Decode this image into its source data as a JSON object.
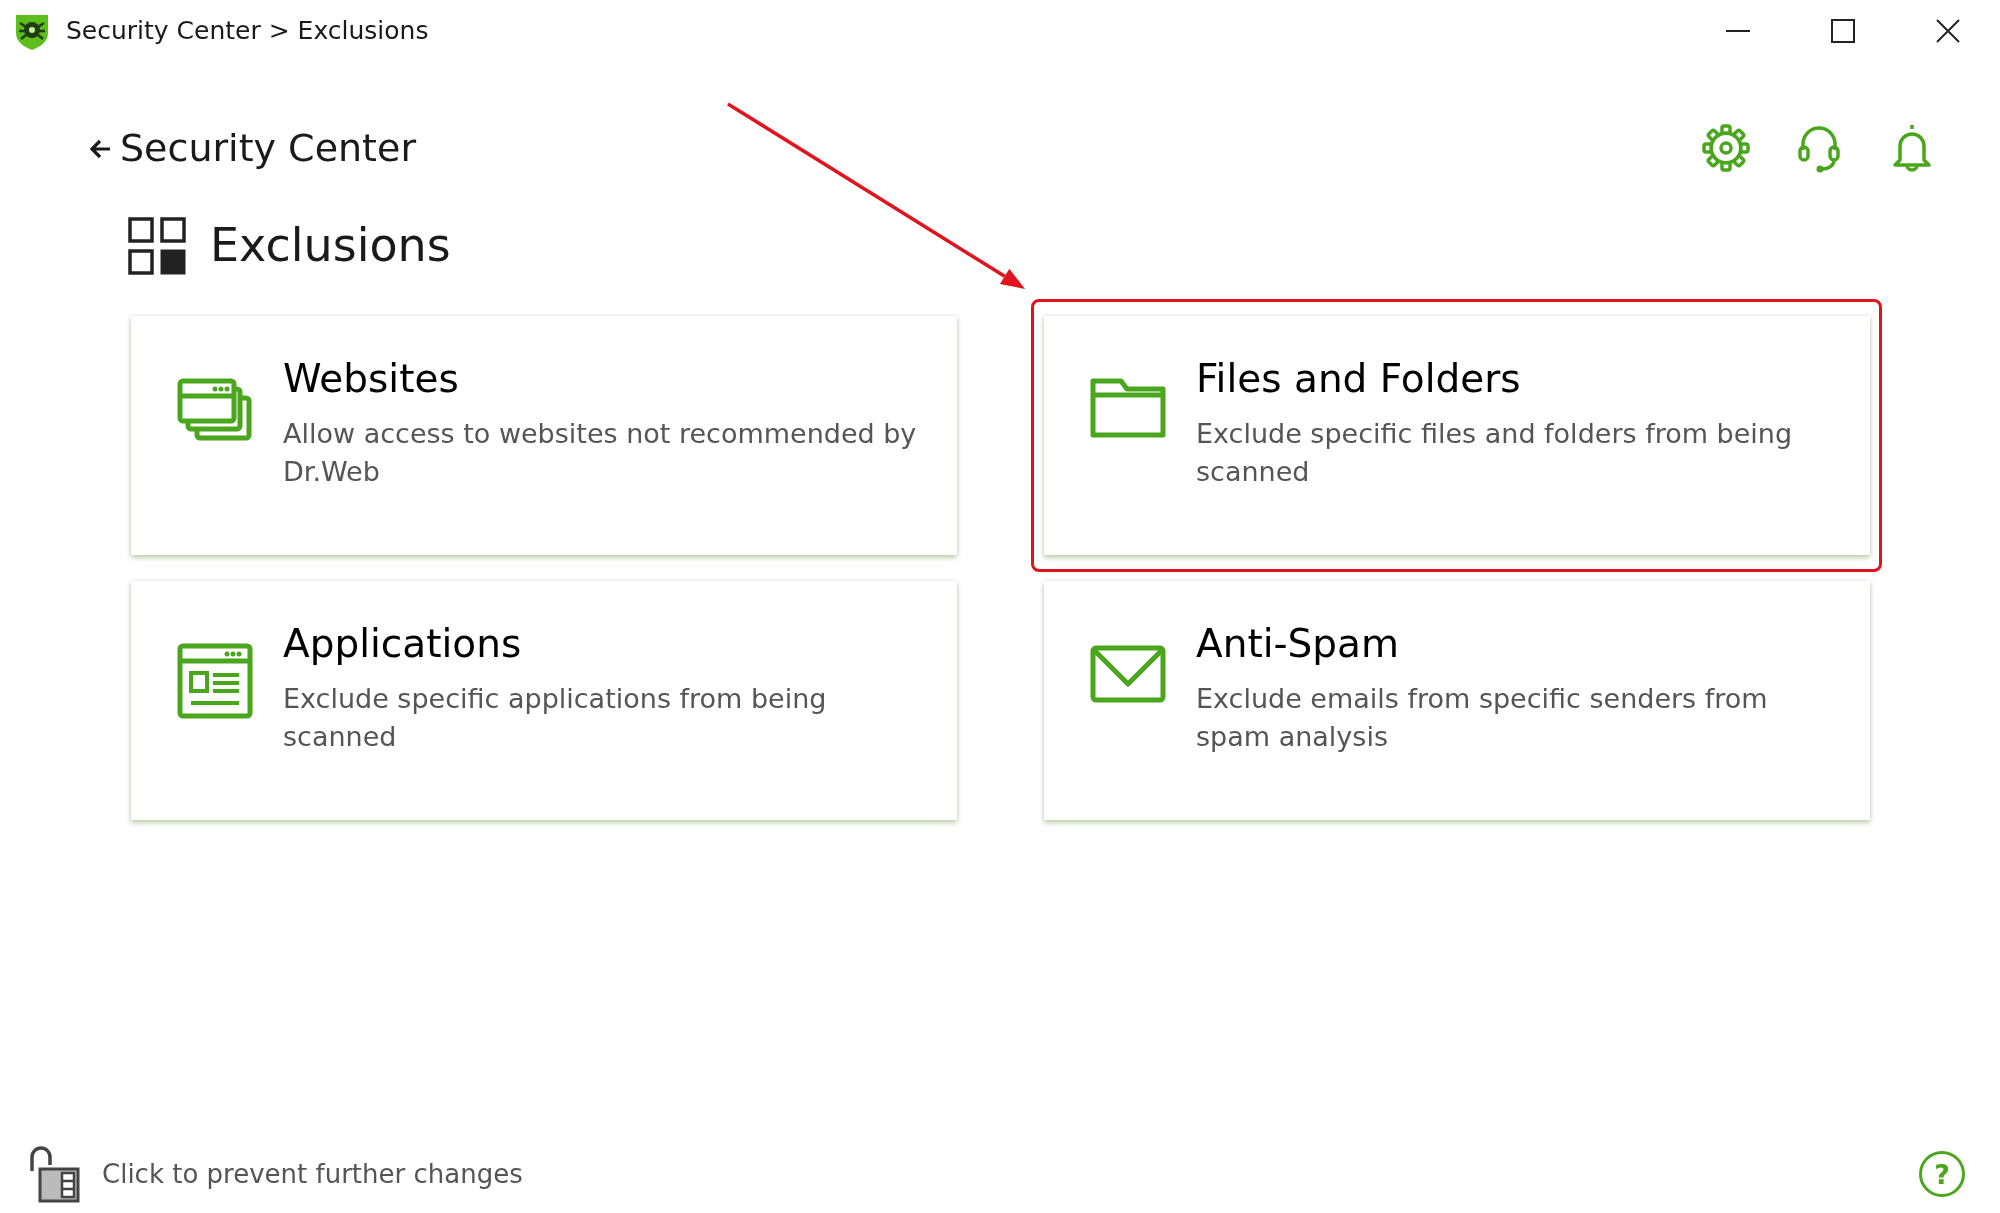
{
  "window": {
    "title": "Security Center > Exclusions"
  },
  "back": {
    "label": "Security Center"
  },
  "heading": "Exclusions",
  "cards": [
    {
      "kind": "websites",
      "title": "Websites",
      "description": "Allow access to websites not recommended by Dr.Web",
      "highlighted": false
    },
    {
      "kind": "folder",
      "title": "Files and Folders",
      "description": "Exclude specific files and folders from being scanned",
      "highlighted": true
    },
    {
      "kind": "applications",
      "title": "Applications",
      "description": "Exclude specific applications from being scanned",
      "highlighted": false
    },
    {
      "kind": "mail",
      "title": "Anti-Spam",
      "description": "Exclude emails from specific senders from spam analysis",
      "highlighted": false
    }
  ],
  "footer": {
    "lock_label": "Click to prevent further changes",
    "help": "?"
  }
}
